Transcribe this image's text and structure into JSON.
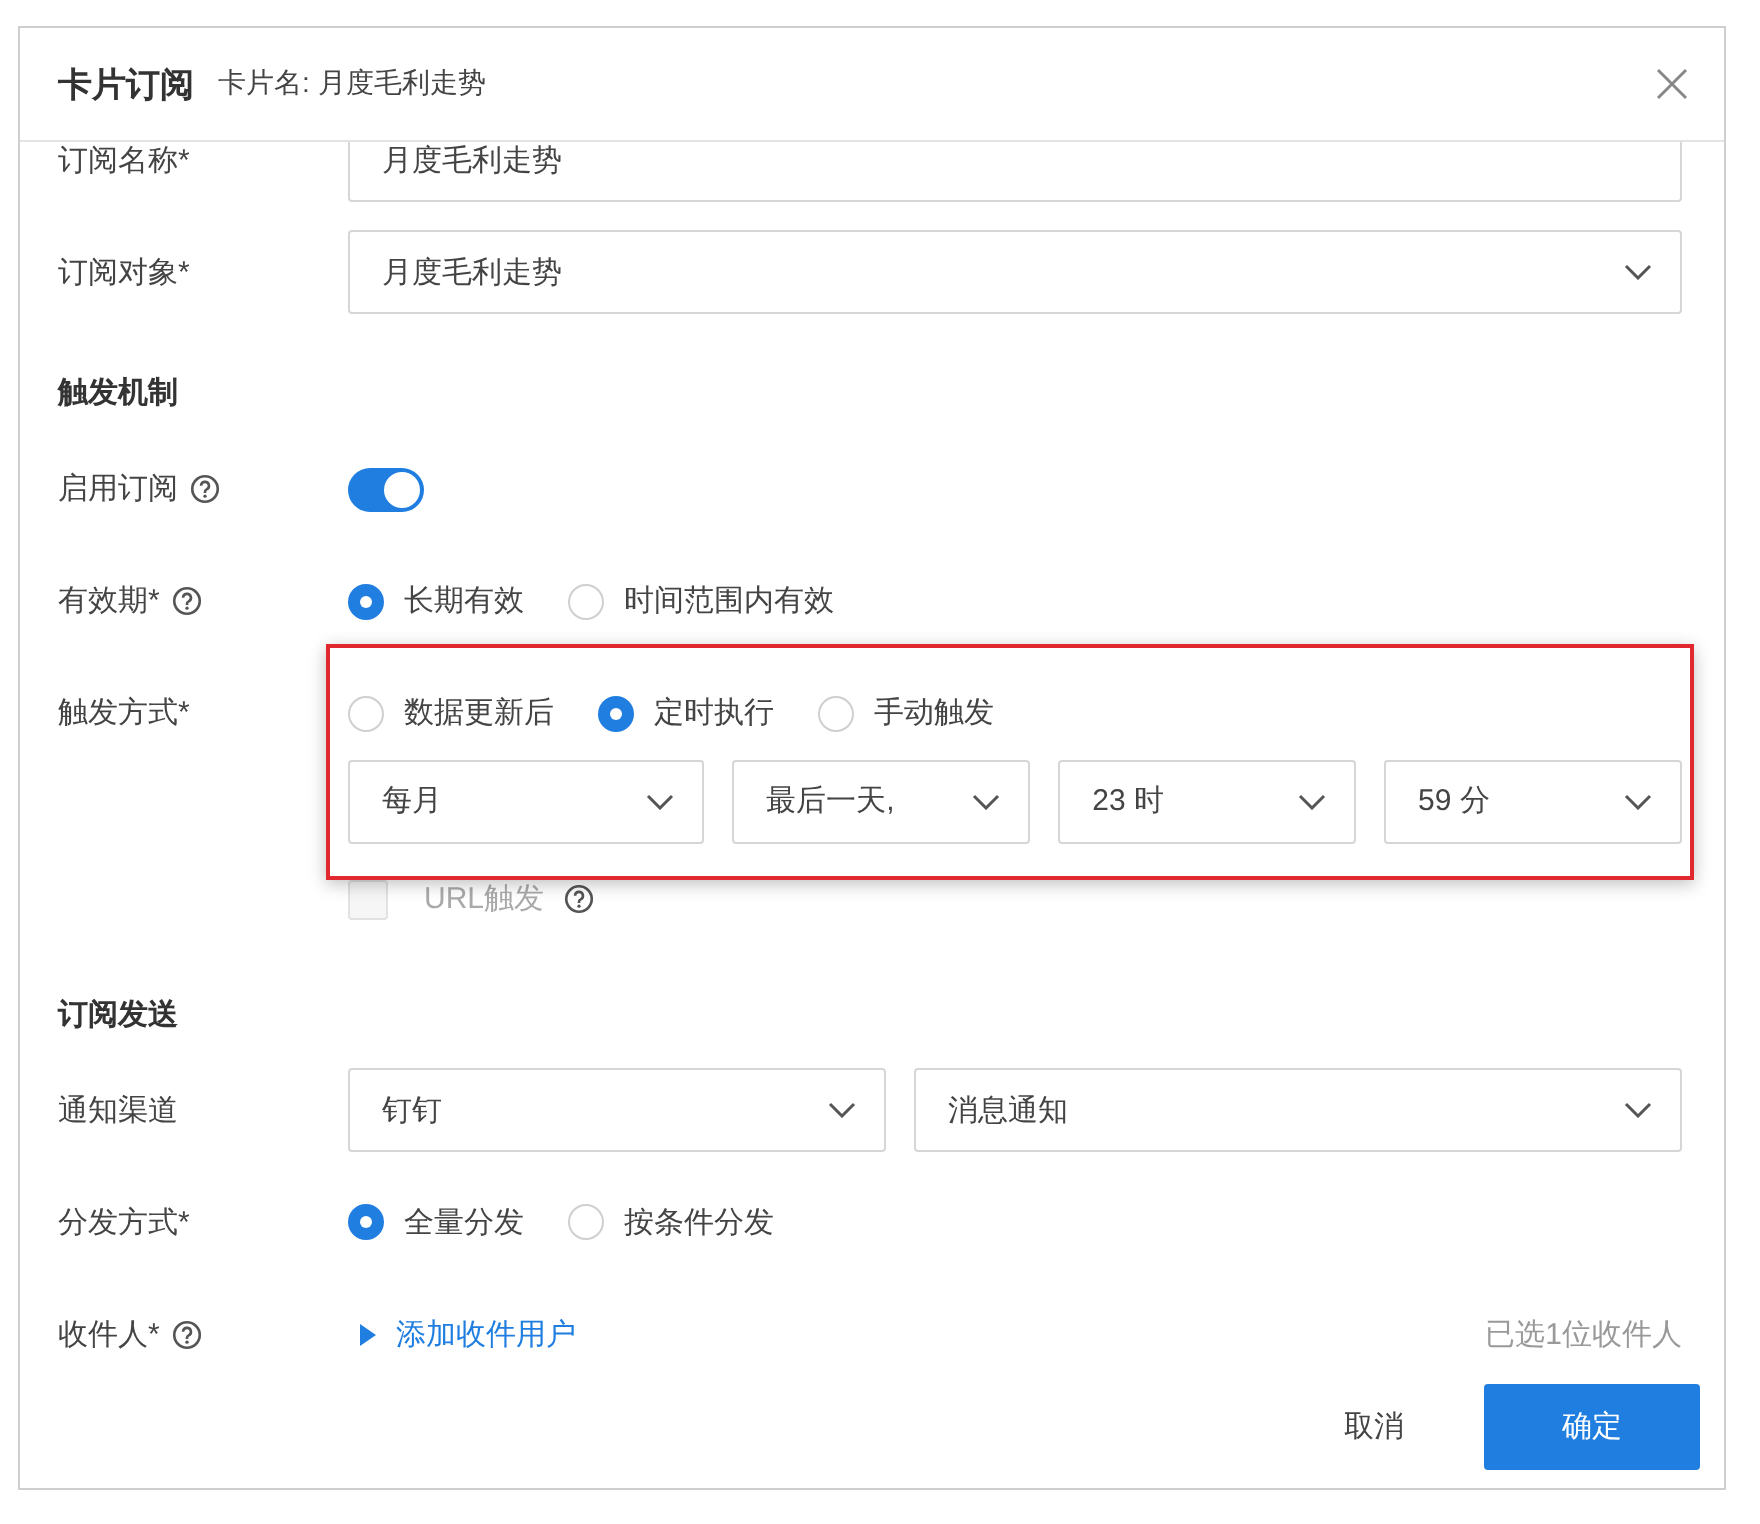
{
  "dialog": {
    "title": "卡片订阅",
    "subtitle": "卡片名: 月度毛利走势"
  },
  "rows": [
    {
      "kind": "input",
      "label": "订阅名称*",
      "value": "月度毛利走势"
    },
    {
      "kind": "select",
      "label": "订阅对象*",
      "value": "月度毛利走势"
    },
    {
      "kind": "section",
      "label": "触发机制"
    },
    {
      "kind": "switch",
      "label": "启用订阅",
      "help": true,
      "on": true
    },
    {
      "kind": "radio",
      "label": "有效期*",
      "help": true,
      "options": [
        {
          "label": "长期有效",
          "selected": true
        },
        {
          "label": "时间范围内有效",
          "selected": false
        }
      ]
    },
    {
      "kind": "trigger",
      "label": "触发方式*",
      "highlighted": true,
      "options": [
        {
          "label": "数据更新后",
          "selected": false
        },
        {
          "label": "定时执行",
          "selected": true
        },
        {
          "label": "手动触发",
          "selected": false
        }
      ],
      "selects": [
        "每月",
        "最后一天,",
        "23 时",
        "59 分"
      ],
      "url_trigger": {
        "label": "URL触发",
        "checked": false,
        "disabled": true,
        "help": true
      }
    },
    {
      "kind": "section",
      "label": "订阅发送"
    },
    {
      "kind": "selects",
      "label": "通知渠道",
      "selects": [
        "钉钉",
        "消息通知"
      ]
    },
    {
      "kind": "radio",
      "label": "分发方式*",
      "options": [
        {
          "label": "全量分发",
          "selected": true
        },
        {
          "label": "按条件分发",
          "selected": false
        }
      ]
    },
    {
      "kind": "recipients",
      "label": "收件人*",
      "help": true,
      "link": "添加收件用户",
      "count": "已选1位收件人"
    }
  ],
  "buttons": [
    {
      "kind": "text",
      "label": "取消"
    },
    {
      "kind": "primary",
      "label": "确定"
    }
  ]
}
